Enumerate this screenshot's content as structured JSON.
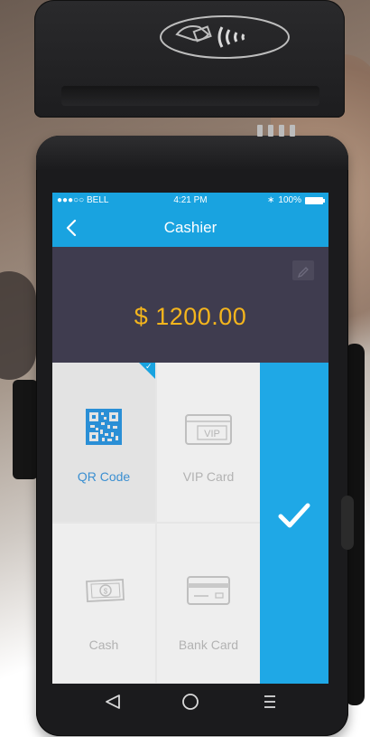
{
  "status_bar": {
    "carrier": "●●●○○ BELL",
    "time": "4:21 PM",
    "battery": "100%"
  },
  "header": {
    "title": "Cashier",
    "back_icon": "chevron-left-icon"
  },
  "amount": {
    "value": "$ 1200.00",
    "edit_icon": "pencil-icon"
  },
  "payment_methods": [
    {
      "label": "QR Code",
      "icon": "qr-code-icon",
      "selected": true
    },
    {
      "label": "VIP Card",
      "icon": "vip-card-icon",
      "badge": "VIP",
      "selected": false
    },
    {
      "label": "Cash",
      "icon": "cash-icon",
      "selected": false
    },
    {
      "label": "Bank Card",
      "icon": "bank-card-icon",
      "selected": false
    }
  ],
  "confirm": {
    "icon": "checkmark-icon"
  },
  "nav": {
    "back_icon": "triangle-back-icon",
    "home_icon": "circle-home-icon",
    "menu_icon": "menu-icon"
  },
  "colors": {
    "accent": "#19a3e0",
    "amount": "#f4b51d",
    "amount_bg": "#3f3c4f",
    "active_label": "#3b8fd1"
  }
}
